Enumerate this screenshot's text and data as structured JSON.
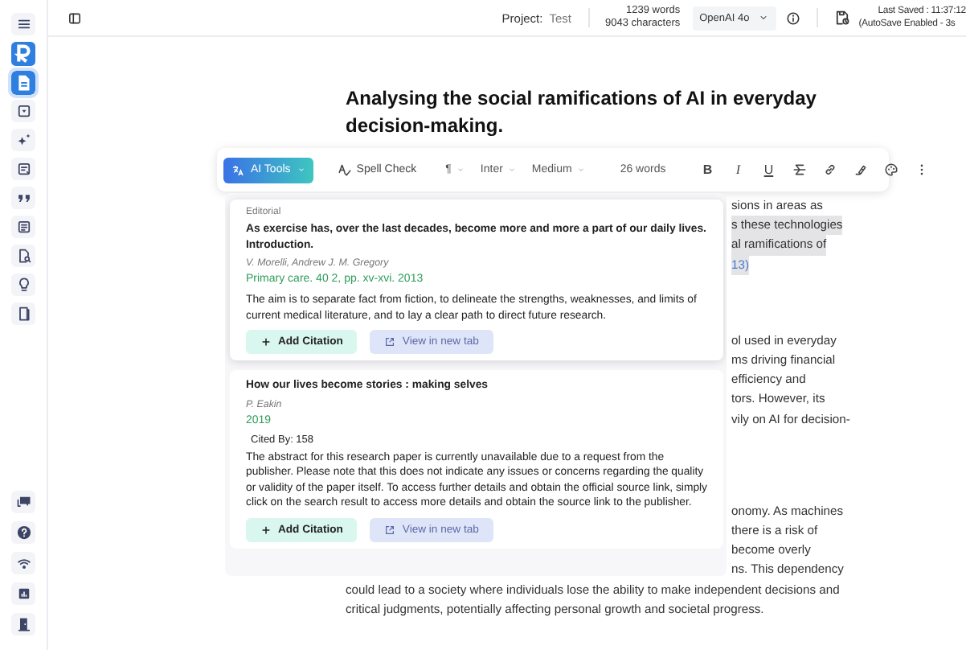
{
  "sidebar": {
    "items": [
      {
        "kind": "menu",
        "selected": false
      },
      {
        "kind": "logo",
        "selected": false
      },
      {
        "kind": "document",
        "selected": true
      },
      {
        "kind": "box",
        "selected": false
      },
      {
        "kind": "sparkle",
        "selected": false
      },
      {
        "kind": "note",
        "selected": false
      },
      {
        "kind": "quote",
        "selected": false
      },
      {
        "kind": "list",
        "selected": false
      },
      {
        "kind": "file-search",
        "selected": false
      },
      {
        "kind": "bulb",
        "selected": false
      },
      {
        "kind": "bookmark",
        "selected": false
      }
    ],
    "bottom_items": [
      {
        "kind": "chat",
        "selected": false
      },
      {
        "kind": "help",
        "selected": false
      },
      {
        "kind": "network",
        "selected": false
      },
      {
        "kind": "chart",
        "selected": false
      },
      {
        "kind": "exit",
        "selected": false
      }
    ]
  },
  "top_bar": {
    "project_label": "Project:",
    "project_name": "Test",
    "word_count": "1239 words",
    "char_count": "9043 characters",
    "model": "OpenAI 4o",
    "last_saved": "Last Saved : 11:37:12",
    "autosave": "(AutoSave Enabled - 3s"
  },
  "document": {
    "title": "Analysing the social ramifications of AI in everyday decision-making.",
    "paragraphs": [
      {
        "lines": [
          {
            "text": "sions in areas as",
            "kind": "text",
            "highlighted": false
          },
          {
            "text": "s these technologies",
            "kind": "text",
            "highlighted": true
          },
          {
            "text": "al ramifications of",
            "kind": "text",
            "highlighted": true
          },
          {
            "text": "13)",
            "kind": "link",
            "highlighted": true
          }
        ]
      },
      {
        "lines": [
          {
            "text": "ol used in everyday",
            "kind": "text",
            "highlighted": false
          },
          {
            "text": "ms driving financial",
            "kind": "text",
            "highlighted": false
          },
          {
            "text": "efficiency and",
            "kind": "text",
            "highlighted": false
          },
          {
            "text": "tors. However, its",
            "kind": "text",
            "highlighted": false
          },
          {
            "text": "vily on AI for decision-",
            "kind": "text",
            "highlighted": false
          }
        ]
      },
      {
        "lines": [
          {
            "text": "onomy. As machines",
            "kind": "text",
            "highlighted": false
          },
          {
            "text": "there is a risk of",
            "kind": "text",
            "highlighted": false
          },
          {
            "text": "become overly",
            "kind": "text",
            "highlighted": false
          },
          {
            "text": "ns. This dependency",
            "kind": "text",
            "highlighted": false
          },
          {
            "text": "could lead to a society where individuals lose the ability to make independent decisions and",
            "kind": "full",
            "highlighted": false
          },
          {
            "text": "critical judgments, potentially affecting personal growth and societal progress.",
            "kind": "full",
            "highlighted": false
          }
        ]
      }
    ]
  },
  "toolbar": {
    "ai_tools": "AI Tools",
    "spell_check": "Spell Check",
    "paragraph": "¶",
    "font": "Inter",
    "weight": "Medium",
    "word_count": "26 words",
    "format": [
      {
        "kind": "bold",
        "label": "B"
      },
      {
        "kind": "italic",
        "label": "I"
      },
      {
        "kind": "underline",
        "label": "U"
      },
      {
        "kind": "strikethrough"
      },
      {
        "kind": "link"
      },
      {
        "kind": "highlight"
      },
      {
        "kind": "palette"
      },
      {
        "kind": "more"
      }
    ]
  },
  "citations": [
    {
      "category": "Editorial",
      "title": "As exercise has, over the last decades, become more and more a part of our daily lives. Introduction.",
      "authors": "V. Morelli, Andrew J. M. Gregory",
      "source": "Primary care. 40 2, pp. xv-xvi. 2013",
      "abstract": "The aim is to separate fact from fiction, to delineate the strengths, weaknesses, and limits of current medical literature, and to lay a clear path to direct future research.",
      "buttons": [
        "Add Citation",
        "View in new tab"
      ]
    },
    {
      "title": "How our lives become stories : making selves",
      "authors": "P. Eakin",
      "source": "2019",
      "cited_by": "Cited By: 158",
      "abstract": "The abstract for this research paper is currently unavailable due to a request from the publisher. Please note that this does not indicate any issues or concerns regarding the quality or validity of the paper itself. To access further details and obtain the official source link, simply click on the search result to access more details and obtain the source link to the publisher.",
      "buttons": [
        "Add Citation",
        "View in new tab"
      ]
    }
  ]
}
